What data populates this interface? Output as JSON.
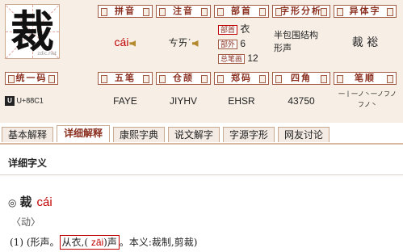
{
  "character": {
    "glyph": "裁",
    "watermark": "zdic.net"
  },
  "headers": {
    "pinyin": "拼音",
    "zhuyin": "注音",
    "bushou": "部首",
    "structure": "字形分析",
    "variant": "异体字",
    "unicode": "统一码",
    "wubi": "五笔",
    "cangjie": "仓颉",
    "zhengma": "郑码",
    "sijiao": "四角",
    "bishun": "笔顺"
  },
  "values": {
    "pinyin": "cái",
    "zhuyin": "ㄘㄞˊ",
    "bushou_label": "部首",
    "bushou_value": "衣",
    "buwai_label": "部外",
    "buwai_value": "6",
    "zongbihua_label": "总笔画",
    "zongbihua_value": "12",
    "structure_line1": "半包围结构",
    "structure_line2": "形声",
    "variant": "裁 䙂",
    "unicode_logo": "U",
    "unicode": "U+88C1",
    "wubi": "FAYE",
    "cangjie": "JIYHV",
    "zhengma": "EHSR",
    "sijiao": "43750",
    "bishun_line1": "一丨一ノ丶一ノフノ",
    "bishun_line2": "フノ丶"
  },
  "tabs": [
    {
      "label": "基本解释",
      "active": false
    },
    {
      "label": "详细解释",
      "active": true
    },
    {
      "label": "康熙字典",
      "active": false
    },
    {
      "label": "说文解字",
      "active": false
    },
    {
      "label": "字源字形",
      "active": false
    },
    {
      "label": "网友讨论",
      "active": false
    }
  ],
  "content": {
    "heading": "详细字义",
    "entry_marker": "◎",
    "entry_char": "裁",
    "entry_pinyin": "cái",
    "pos": "〈动〉",
    "def_prefix": "(1)  (形声。",
    "def_boxed_pre": "从衣,(",
    "def_boxed_py": "zāi",
    "def_boxed_post": ")声",
    "def_suffix": "。本义:裁制,剪裁)"
  },
  "colors": {
    "accent": "#8b2f1f",
    "pinyin": "#c00000",
    "panel": "#f7efe6"
  }
}
